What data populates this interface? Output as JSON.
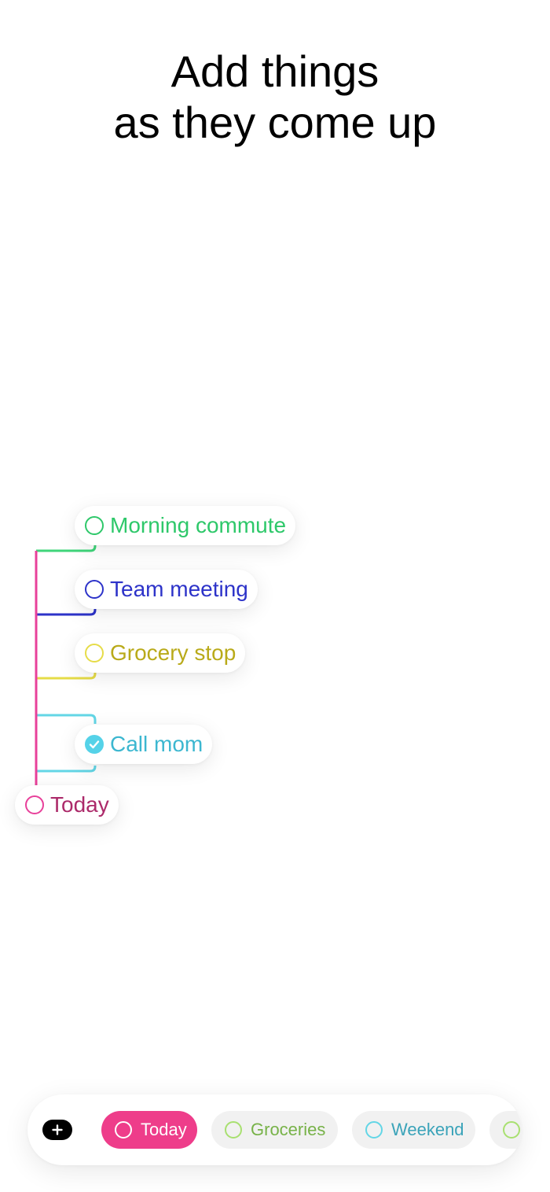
{
  "headline": {
    "line1": "Add things",
    "line2": "as they come up"
  },
  "tasks": [
    {
      "label": "Morning commute",
      "color": "#2ec86a",
      "done": false
    },
    {
      "label": "Team meeting",
      "color": "#2d33c9",
      "done": false
    },
    {
      "label": "Grocery stop",
      "color": "#b9aa19",
      "done": false
    },
    {
      "label": "Call mom",
      "color": "#3cb7d0",
      "done": true
    },
    {
      "label": "Today",
      "color": "#ac2a6a",
      "done": false
    }
  ],
  "branch_colors": {
    "trunk": "#e8409a",
    "green": "#3fd57a",
    "blue": "#2d33c9",
    "yellow": "#e6dc48",
    "cyan": "#63d6e6"
  },
  "bottom_bar": {
    "add_icon": "plus-icon",
    "chips": [
      {
        "label": "Today",
        "selected": true,
        "color": "#ee3d8a"
      },
      {
        "label": "Groceries",
        "selected": false,
        "color": "#77b248"
      },
      {
        "label": "Weekend",
        "selected": false,
        "color": "#3aa3b9"
      },
      {
        "label": "",
        "selected": false,
        "color": "#a8e070"
      }
    ]
  }
}
